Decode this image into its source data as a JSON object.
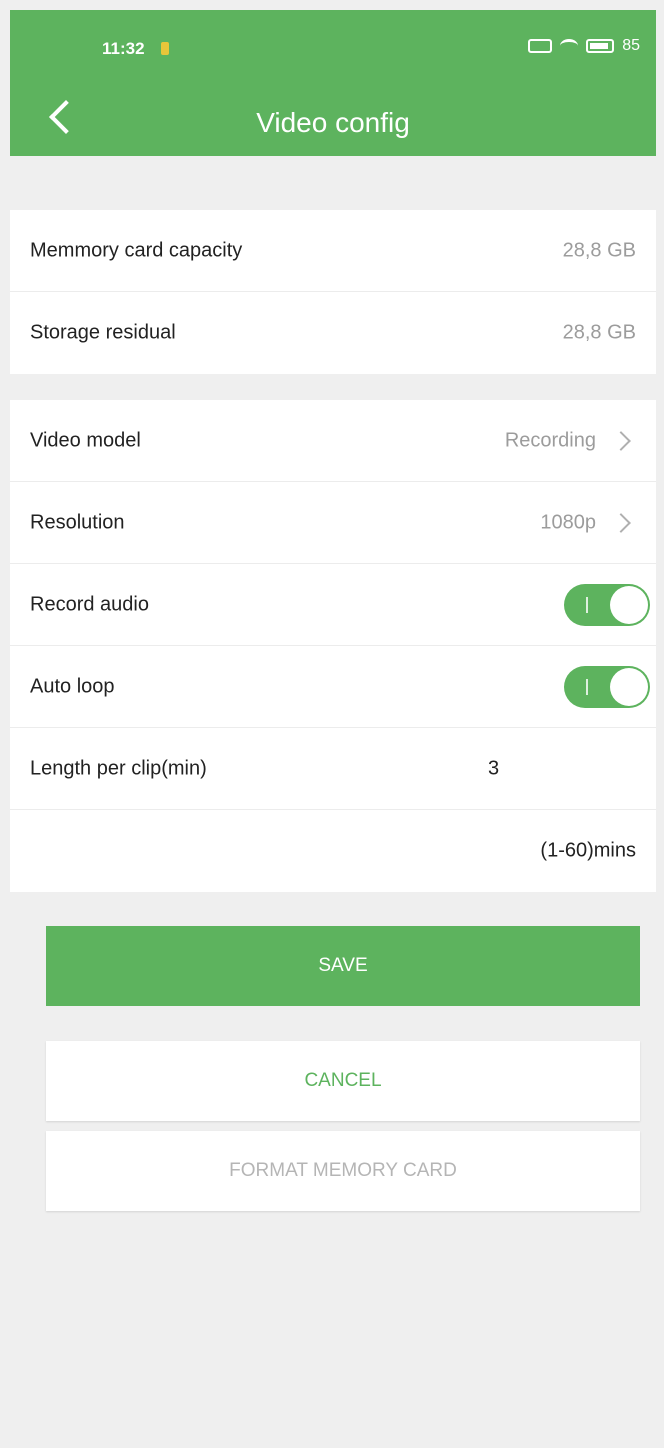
{
  "status_bar": {
    "time": "11:32",
    "battery": "85"
  },
  "header": {
    "title": "Video config"
  },
  "storage": {
    "rows": [
      {
        "label": "Memmory card capacity",
        "value": "28,8 GB"
      },
      {
        "label": "Storage residual",
        "value": "28,8 GB"
      }
    ]
  },
  "settings": {
    "video_model": {
      "label": "Video model",
      "value": "Recording"
    },
    "resolution": {
      "label": "Resolution",
      "value": "1080p"
    },
    "record_audio": {
      "label": "Record audio",
      "enabled": true
    },
    "auto_loop": {
      "label": "Auto loop",
      "enabled": true
    },
    "clip_length": {
      "label": "Length per clip(min)",
      "value": "3",
      "hint": "(1-60)mins"
    }
  },
  "buttons": {
    "save": "SAVE",
    "cancel": "CANCEL",
    "format": "FORMAT MEMORY CARD"
  },
  "colors": {
    "accent": "#5db35e",
    "background": "#efefef",
    "muted_text": "#9c9c9c"
  }
}
